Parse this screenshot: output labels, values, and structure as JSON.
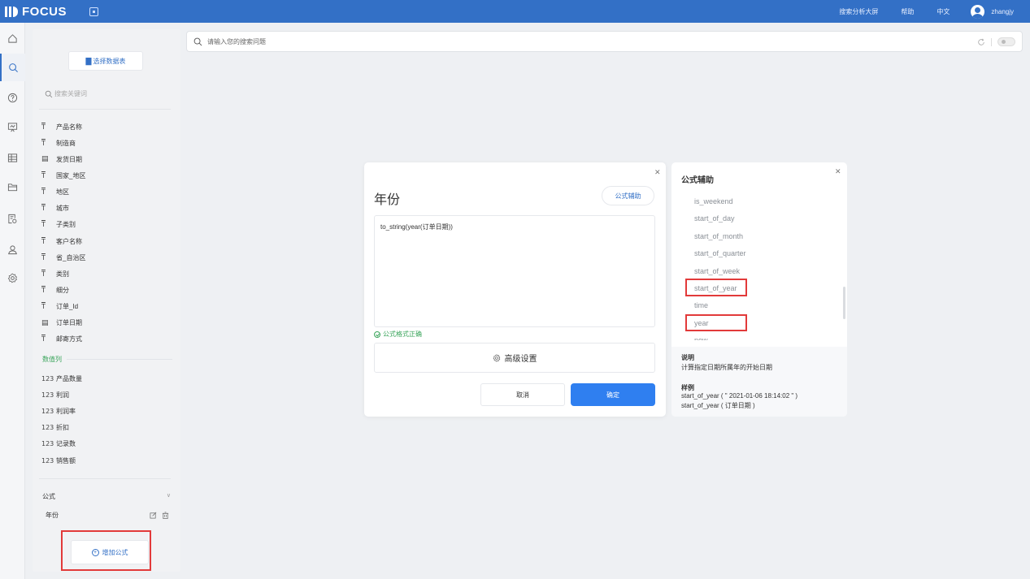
{
  "topbar": {
    "brand": "FOCUS",
    "links": [
      "搜索分析大屏",
      "帮助",
      "中文"
    ],
    "username": "zhangjy",
    "accent_color": "#3370c6"
  },
  "rail": {
    "icons": [
      "home-icon",
      "search-icon",
      "help-icon",
      "board-icon",
      "table-icon",
      "folder-icon",
      "report-icon",
      "user-icon",
      "settings-icon"
    ],
    "active": "search-icon"
  },
  "panel": {
    "select_datasource_label": "选择数据表",
    "search_placeholder": "搜索关键词",
    "dimension_fields": [
      {
        "type": "text",
        "name": "产品名称"
      },
      {
        "type": "text",
        "name": "制造商"
      },
      {
        "type": "date",
        "name": "发货日期"
      },
      {
        "type": "text",
        "name": "国家_地区"
      },
      {
        "type": "text",
        "name": "地区"
      },
      {
        "type": "text",
        "name": "城市"
      },
      {
        "type": "text",
        "name": "子类别"
      },
      {
        "type": "text",
        "name": "客户名称"
      },
      {
        "type": "text",
        "name": "省_自治区"
      },
      {
        "type": "text",
        "name": "类别"
      },
      {
        "type": "text",
        "name": "细分"
      },
      {
        "type": "text",
        "name": "订单_Id"
      },
      {
        "type": "date",
        "name": "订单日期"
      },
      {
        "type": "text",
        "name": "邮寄方式"
      }
    ],
    "measure_section_label": "数值列",
    "measure_fields": [
      {
        "type": "number",
        "name": "产品数量"
      },
      {
        "type": "number",
        "name": "利润"
      },
      {
        "type": "number",
        "name": "利润率"
      },
      {
        "type": "number",
        "name": "折扣"
      },
      {
        "type": "number",
        "name": "记录数"
      },
      {
        "type": "number",
        "name": "销售额"
      }
    ],
    "formula_section_label": "公式",
    "formulas": [
      {
        "name": "年份"
      }
    ],
    "add_formula_label": "增加公式"
  },
  "search": {
    "placeholder": "请输入您的搜索问题"
  },
  "dialog": {
    "title": "年份",
    "helper_button_label": "公式辅助",
    "formula_text": "to_string(year(订单日期))",
    "validation_message": "公式格式正确",
    "advanced_label": "高级设置",
    "cancel_label": "取消",
    "confirm_label": "确定",
    "confirm_color": "#2f7ff0"
  },
  "helper": {
    "title": "公式辅助",
    "functions": [
      "is_weekend",
      "start_of_day",
      "start_of_month",
      "start_of_quarter",
      "start_of_week",
      "start_of_year",
      "time",
      "year",
      "now"
    ],
    "description_label": "说明",
    "description_text": "计算指定日期所属年的开始日期",
    "example_label": "样例",
    "examples": [
      "start_of_year ( \" 2021-01-06 18:14:02 \" )",
      "start_of_year ( 订单日期 )"
    ]
  },
  "highlight_color": "#e23a3a"
}
